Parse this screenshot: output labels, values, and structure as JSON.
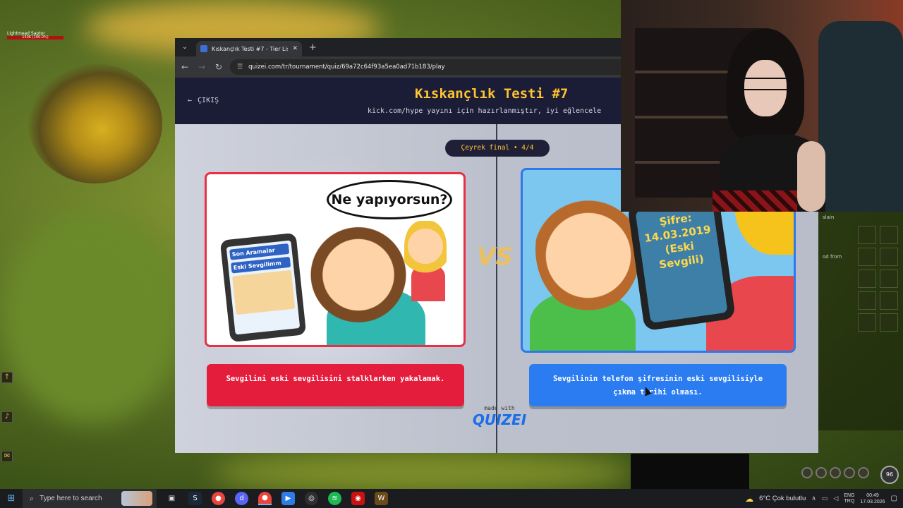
{
  "game": {
    "player_name": "Lightmead Saptor",
    "health_text": "150K (100.0%)",
    "right_panel_lines": [
      "slain",
      "od from"
    ],
    "level": "96"
  },
  "browser": {
    "tab_title": "Kıskançlık Testi #7 - Tier List, Ki",
    "new_tab": "+",
    "url": "quizei.com/tr/tournament/quiz/69a72c64f93a5ea0ad71b183/play"
  },
  "quiz": {
    "exit_label": "ÇIKIŞ",
    "title": "Kıskançlık Testi #7",
    "subtitle": "kick.com/hype yayını için hazırlanmıştır, iyi eğlencele",
    "round": "Çeyrek final • 4/4",
    "vs": "VS",
    "left": {
      "bubble": "Ne yapıyorsun?",
      "phone_row1": "Son Aramalar",
      "phone_row2": "Eski Sevgilimm",
      "caption": "Sevgilini eski sevgilisini stalklarken yakalamak."
    },
    "right": {
      "phone_text": "Şifre: 14.03.2019 (Eski Sevgili)",
      "caption": "Sevgilinin telefon şifresinin eski sevgilisiyle çıkma tarihi olması."
    },
    "made_with": "made with",
    "brand": "QUIZEI"
  },
  "taskbar": {
    "search_placeholder": "Type here to search",
    "weather": "6°C  Çok bulutlu",
    "lang_top": "ENG",
    "lang_bottom": "TRQ",
    "time": "00:49",
    "date": "17.03.2026"
  },
  "colors": {
    "accent_yellow": "#ffc233",
    "left_red": "#e41d3d",
    "right_blue": "#2b7cf0",
    "header_navy": "#1b1c35"
  }
}
